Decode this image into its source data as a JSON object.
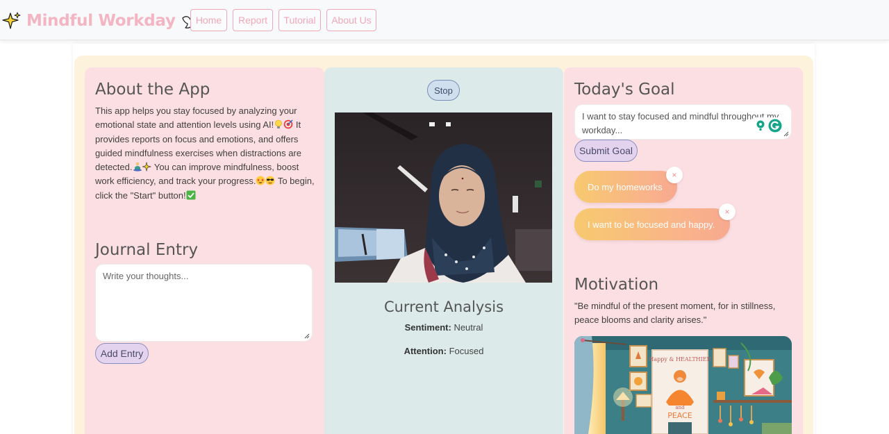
{
  "navbar": {
    "brand": "Mindful Workday",
    "brand_icon_left": "sparkle-icon",
    "brand_icon_right": "dove-icon",
    "links": [
      "Home",
      "Report",
      "Tutorial",
      "About Us"
    ]
  },
  "about": {
    "title": "About the App",
    "text_1": "This app helps you stay focused by analyzing your emotional state and attention levels using AI!",
    "text_2": " It provides reports on focus and emotions, and offers guided mindfulness exercises when distractions are detected.",
    "text_3": " You can improve mindfulness, boost work efficiency, and track your progress.",
    "text_4": " To begin, click the \"Start\" button!"
  },
  "journal": {
    "title": "Journal Entry",
    "placeholder": "Write your thoughts...",
    "add_label": "Add Entry"
  },
  "camera": {
    "stop_label": "Stop",
    "analysis_title": "Current Analysis",
    "sentiment_label": "Sentiment:",
    "sentiment_value": "Neutral",
    "attention_label": "Attention:",
    "attention_value": "Focused"
  },
  "goal": {
    "title": "Today's Goal",
    "input_value": "I want to stay focused and mindful throughout my workday...",
    "submit_label": "Submit Goal",
    "items": [
      "Do my homeworks",
      "I want to be focused and happy."
    ],
    "close_symbol": "×"
  },
  "motivation": {
    "title": "Motivation",
    "quote": "\"Be mindful of the present moment, for in stillness, peace blooms and clarity arises.\"",
    "poster_text_1": "Happy & HEALTHIER",
    "poster_text_2": "and",
    "poster_text_3": "PEACE"
  },
  "colors": {
    "brand": "#f4b5c3",
    "pink_panel": "#fcdfe3",
    "mint_panel": "#dcebe9",
    "cream": "#fdf3dc",
    "button_fill": "#e3d3ef"
  }
}
